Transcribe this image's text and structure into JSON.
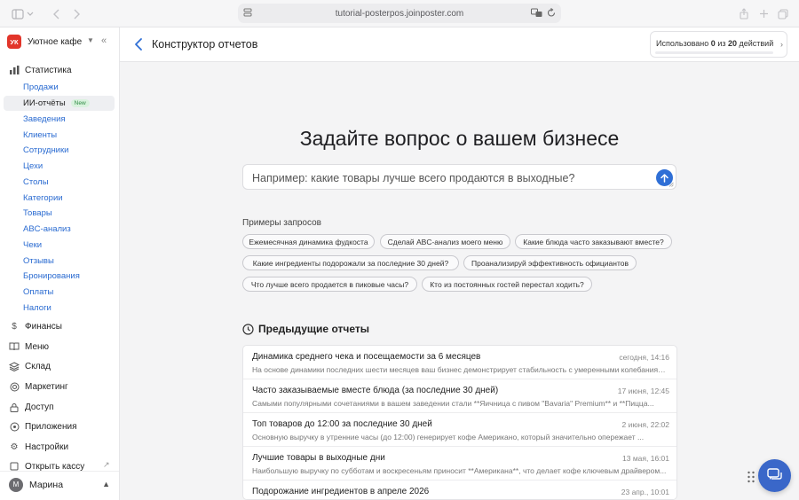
{
  "browser": {
    "url": "tutorial-posterpos.joinposter.com"
  },
  "sidebar": {
    "brand_initials": "УК",
    "brand_name": "Уютное кафе",
    "statistics_label": "Статистика",
    "stat_items": [
      {
        "label": "Продажи"
      },
      {
        "label": "ИИ-отчёты",
        "badge": "New",
        "active": true
      },
      {
        "label": "Заведения"
      },
      {
        "label": "Клиенты"
      },
      {
        "label": "Сотрудники"
      },
      {
        "label": "Цехи"
      },
      {
        "label": "Столы"
      },
      {
        "label": "Категории"
      },
      {
        "label": "Товары"
      },
      {
        "label": "ABC-анализ"
      },
      {
        "label": "Чеки"
      },
      {
        "label": "Отзывы"
      },
      {
        "label": "Бронирования"
      },
      {
        "label": "Оплаты"
      },
      {
        "label": "Налоги"
      }
    ],
    "sections": [
      {
        "label": "Финансы",
        "icon": "dollar-icon"
      },
      {
        "label": "Меню",
        "icon": "book-icon"
      },
      {
        "label": "Склад",
        "icon": "layers-icon"
      },
      {
        "label": "Маркетинг",
        "icon": "target-icon"
      },
      {
        "label": "Доступ",
        "icon": "lock-icon"
      },
      {
        "label": "Приложения",
        "icon": "apps-icon"
      },
      {
        "label": "Настройки",
        "icon": "gear-icon"
      },
      {
        "label": "Открыть кассу",
        "icon": "register-icon"
      }
    ],
    "user": {
      "initial": "М",
      "name": "Марина"
    }
  },
  "header": {
    "title": "Конструктор отчетов",
    "usage_prefix": "Использовано ",
    "usage_used": "0",
    "usage_mid": " из ",
    "usage_total": "20",
    "usage_suffix": " действий",
    "usage_fraction": 0.0
  },
  "main": {
    "hero_title": "Задайте вопрос о вашем бизнесе",
    "ask_placeholder": "Например: какие товары лучше всего продаются в выходные?",
    "examples_title": "Примеры запросов",
    "examples": [
      "Ежемесячная динамика фудкоста",
      "Сделай ABC-анализ моего меню",
      "Какие блюда часто заказывают вместе?",
      "Какие ингредиенты подорожали за последние 30 дней?",
      "Проанализируй эффективность официантов",
      "Что лучше всего продается в пиковые часы?",
      "Кто из постоянных гостей перестал ходить?"
    ],
    "previous_title": "Предыдущие отчеты",
    "reports": [
      {
        "title": "Динамика среднего чека и посещаемости за 6 месяцев",
        "date": "сегодня, 14:16",
        "summary": "На основе динамики последних шести месяцев ваш бизнес демонстрирует стабильность с умеренными колебаниями..."
      },
      {
        "title": "Часто заказываемые вместе блюда (за последние 30 дней)",
        "date": "17 июня, 12:45",
        "summary": "Самыми популярными сочетаниями в вашем заведении стали **Яичница с пивом \"Bavaria\" Premium** и **Пицца..."
      },
      {
        "title": "Топ товаров до 12:00 за последние 30 дней",
        "date": "2 июня, 22:02",
        "summary": "Основную выручку в утренние часы (до 12:00) генерирует кофе Американо, который значительно опережает ..."
      },
      {
        "title": "Лучшие товары в выходные дни",
        "date": "13 мая, 16:01",
        "summary": "Наибольшую выручку по субботам и воскресеньям приносит **Американа**, что делает кофе ключевым драйвером..."
      },
      {
        "title": "Подорожание ингредиентов в апреле 2026",
        "date": "23 апр., 10:01",
        "summary": ""
      }
    ]
  }
}
